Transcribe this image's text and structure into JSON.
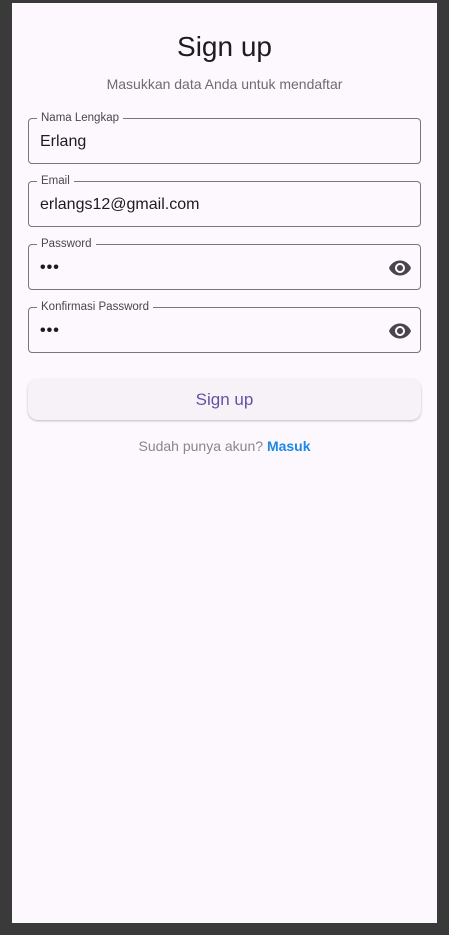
{
  "header": {
    "title": "Sign up",
    "subtitle": "Masukkan data Anda untuk mendaftar"
  },
  "form": {
    "full_name": {
      "label": "Nama Lengkap",
      "value": "Erlang"
    },
    "email": {
      "label": "Email",
      "value": "erlangs12@gmail.com"
    },
    "password": {
      "label": "Password",
      "value": "•••",
      "icon": "eye-icon"
    },
    "confirm_password": {
      "label": "Konfirmasi Password",
      "value": "•••",
      "icon": "eye-icon"
    }
  },
  "actions": {
    "signup_label": "Sign up"
  },
  "footer": {
    "prompt": "Sudah punya akun?",
    "login_link": "Masuk"
  },
  "colors": {
    "background": "#fdf7fe",
    "primary": "#6750a4",
    "link": "#1e88e5",
    "outline": "#79747e"
  }
}
